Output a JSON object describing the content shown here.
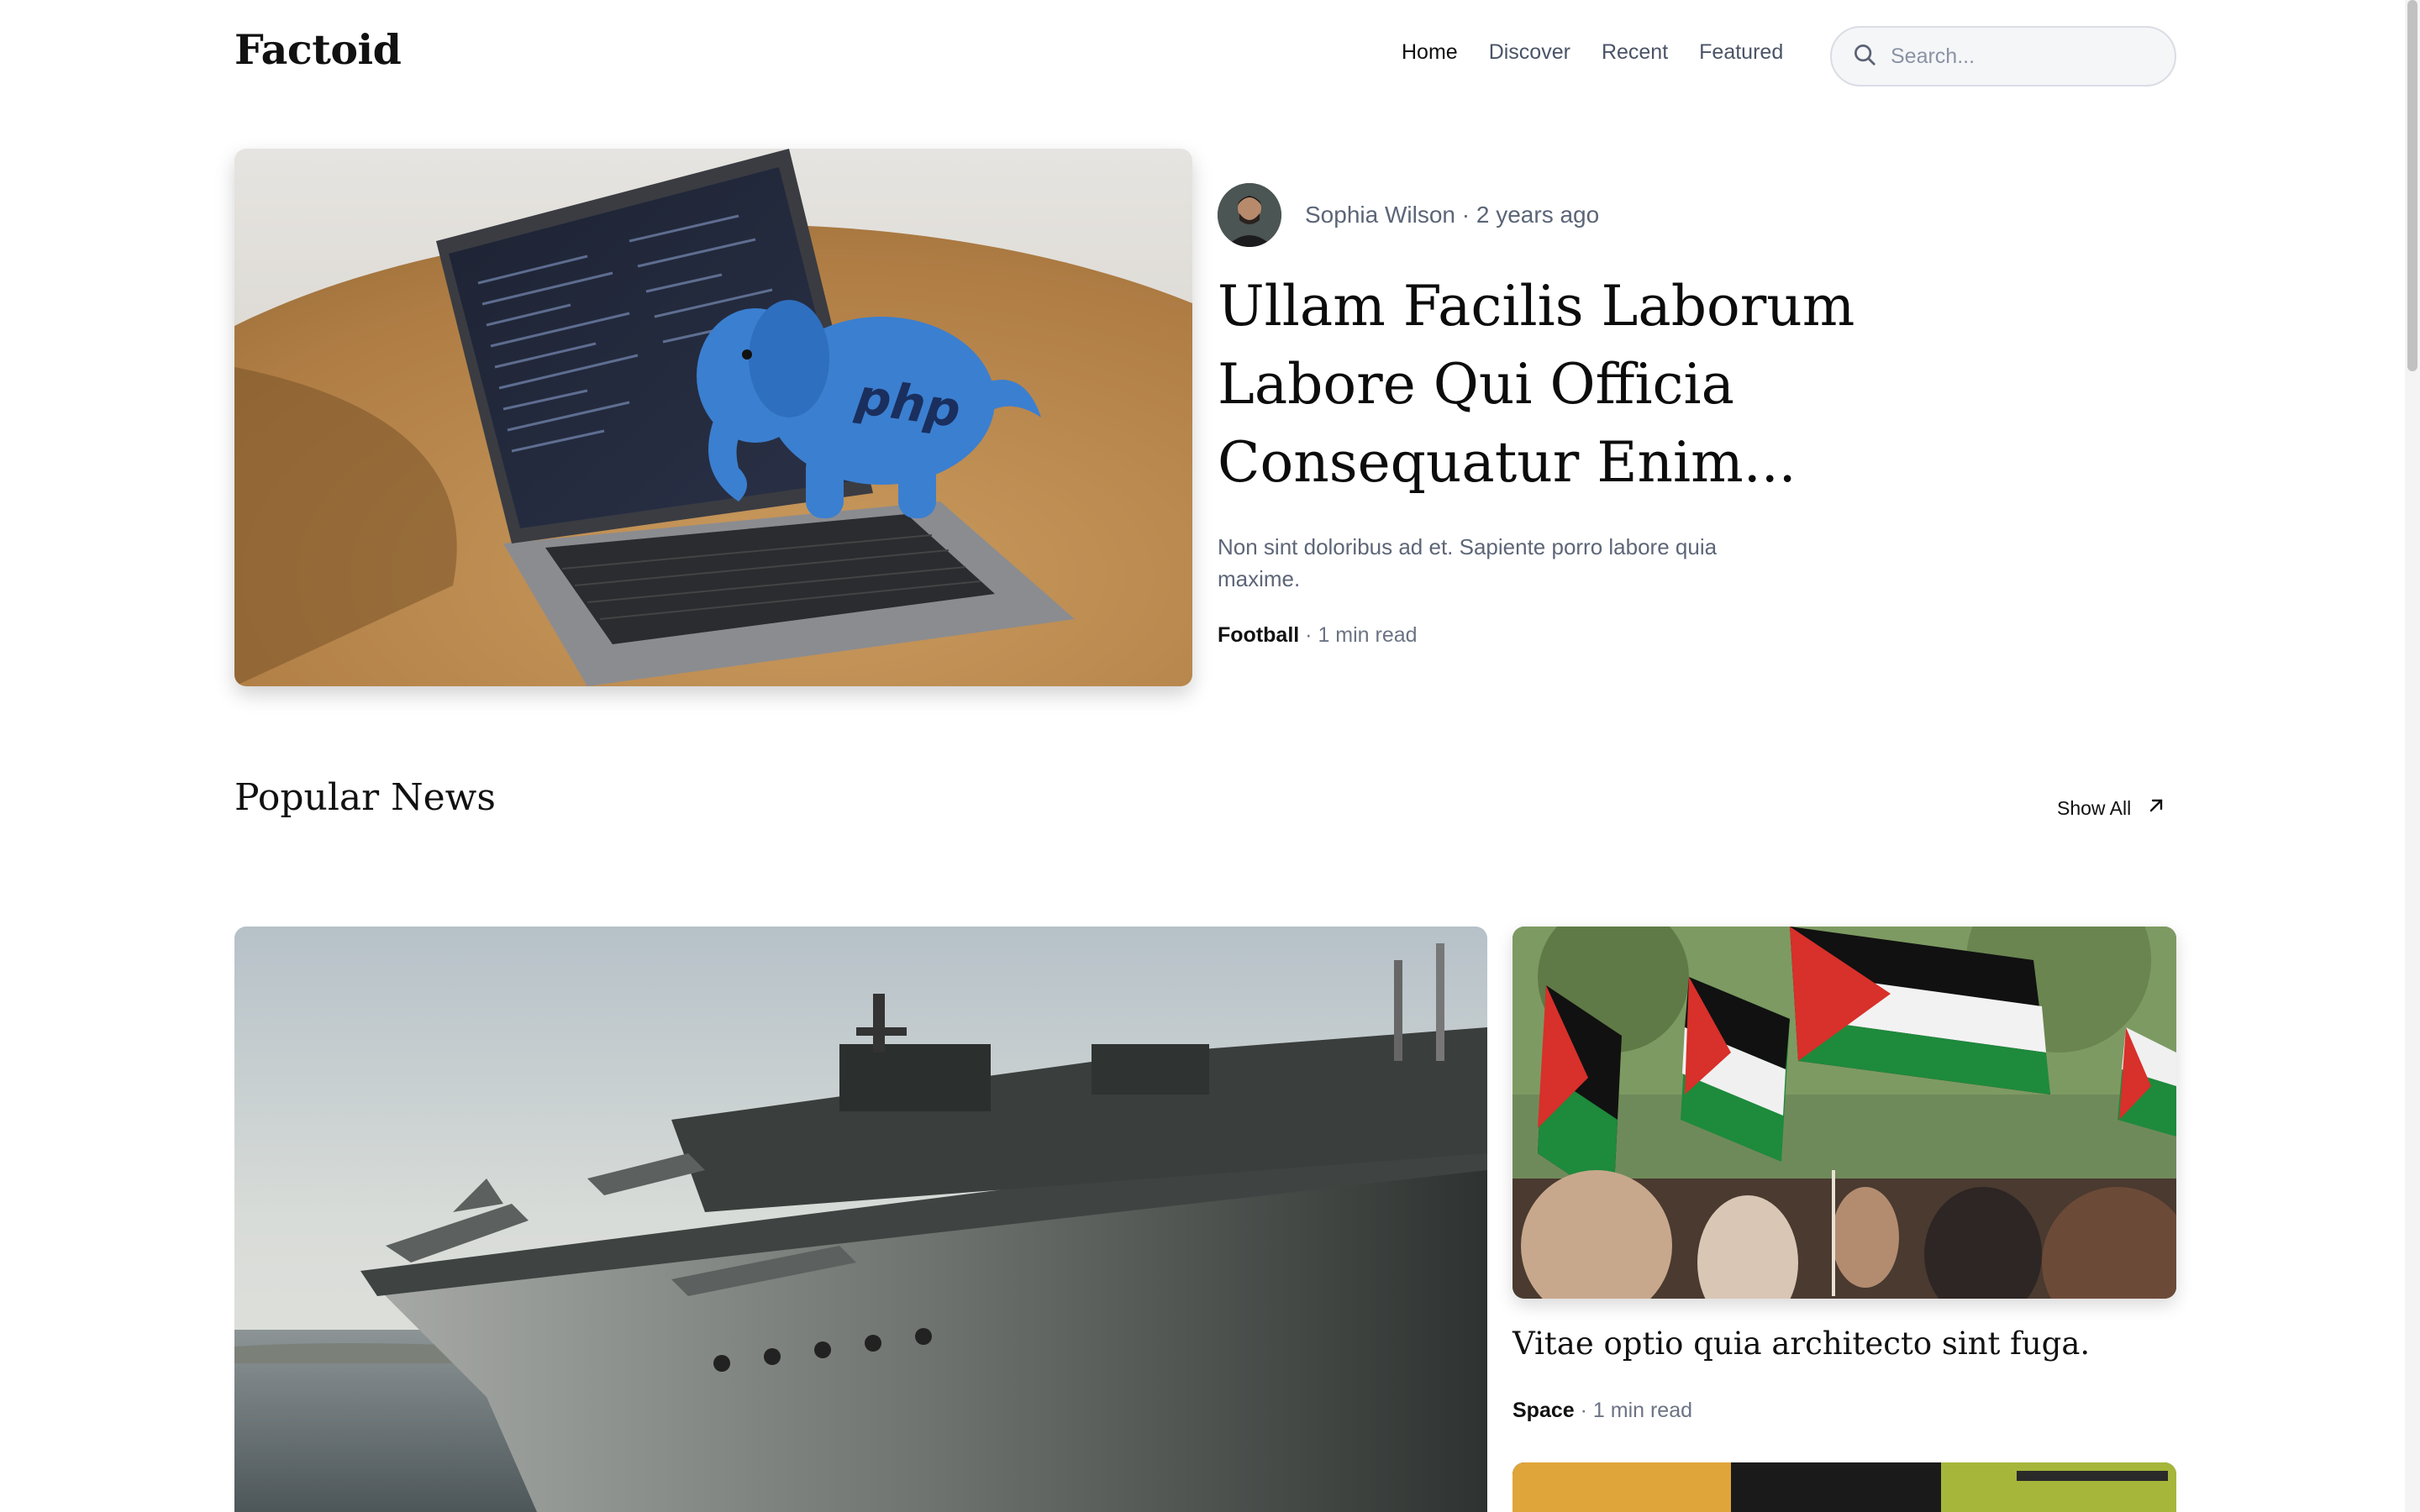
{
  "header": {
    "logo": "Factoid",
    "nav": [
      {
        "label": "Home",
        "active": true
      },
      {
        "label": "Discover",
        "active": false
      },
      {
        "label": "Recent",
        "active": false
      },
      {
        "label": "Featured",
        "active": false
      }
    ],
    "search_placeholder": "Search..."
  },
  "hero": {
    "image_icon": "laptop-php-elephant-image",
    "author": "Sophia Wilson",
    "time_ago": "2 years ago",
    "byline_separator": "·",
    "title": "Ullam Facilis Laborum Labore Qui Officia Consequatur Enim...",
    "excerpt": "Non sint doloribus ad et. Sapiente porro labore quia maxime.",
    "category": "Football",
    "read_time": "1 min read",
    "meta_separator": "·"
  },
  "popular": {
    "title": "Popular News",
    "show_all": "Show All",
    "featured_image_icon": "aircraft-carrier-image",
    "cards": [
      {
        "image_icon": "protest-flags-image",
        "title": "Vitae optio quia architecto sint fuga.",
        "category": "Space",
        "read_time": "1 min read",
        "meta_separator": "·"
      }
    ],
    "next_card_image_icon": "phone-screen-image"
  },
  "colors": {
    "text": "#111111",
    "muted": "#5b6577",
    "search_bg": "#f5f6f8",
    "border": "#d9dde4"
  }
}
